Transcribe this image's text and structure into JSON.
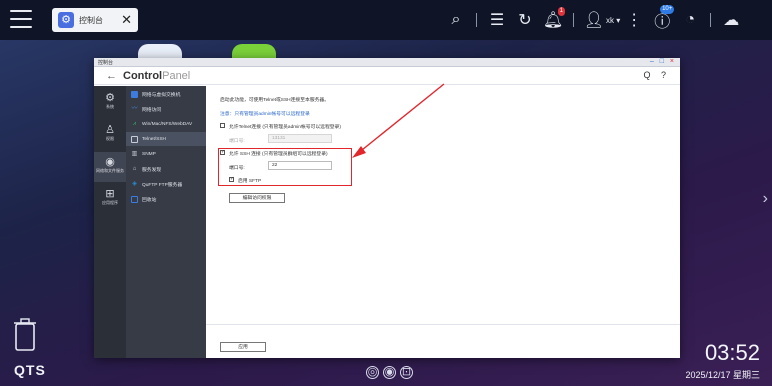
{
  "desktop": {
    "app_tab_label": "控制台",
    "tab_close": "✕",
    "user_name": "xk",
    "badges": {
      "notifications": "1",
      "info": "10+"
    },
    "os_label": "QTS",
    "clock_time": "03:52",
    "clock_date": "2025/12/17 星期三"
  },
  "window": {
    "title": "控制台",
    "controls": {
      "minimize": "–",
      "maximize": "□",
      "close": "×"
    },
    "brand_strong": "Control",
    "brand_light": "Panel",
    "header_icons": "Q ?"
  },
  "rail": [
    {
      "icon": "gear-icon",
      "glyph": "⚙",
      "label": "系统"
    },
    {
      "icon": "user-icon",
      "glyph": "♙",
      "label": "权限"
    },
    {
      "icon": "globe-icon",
      "glyph": "◉",
      "label": "网络和文件服务"
    },
    {
      "icon": "apps-icon",
      "glyph": "⊞",
      "label": "应用程序"
    }
  ],
  "subnav": [
    {
      "icon": "network-switch-icon",
      "label": "网络与虚拟交换机",
      "color": "#3d7be0"
    },
    {
      "icon": "network-access-icon",
      "label": "网络访问",
      "color": "#4a90e2"
    },
    {
      "icon": "win-mac-nfs-icon",
      "label": "Win/Mac/NFS/WebDAV",
      "color": "#3bb36a"
    },
    {
      "icon": "telnet-ssh-icon",
      "label": "Telnet/SSH",
      "color": "#8a94a8"
    },
    {
      "icon": "snmp-icon",
      "label": "SNMP",
      "color": "#6c7a90"
    },
    {
      "icon": "service-discovery-icon",
      "label": "服务发现",
      "color": "#5f6d85"
    },
    {
      "icon": "ftp-icon",
      "label": "QuFTP FTP服务器",
      "color": "#2a8fd8"
    },
    {
      "icon": "recycle-bin-icon",
      "label": "回收站",
      "color": "#3d7be0"
    }
  ],
  "content": {
    "intro": "启动此功能，可使用Telnet或SSH连接至本服务器。",
    "note": "注意：只有管理员admin帐号可以远程登录",
    "telnet_label": "允许Telnet连接 (只有管理员admin帐号可以远程登录)",
    "telnet_port_label": "端口号:",
    "telnet_port_value": "13131",
    "ssh_label": "允许 SSH 连接 (只有管理员群组可以远程登录)",
    "ssh_port_label": "端口号:",
    "ssh_port_value": "22",
    "sftp_label": "启用 SFTP",
    "edit_access_button": "编辑访问权限",
    "apply_button": "应用"
  },
  "states": {
    "telnet_enabled": false,
    "ssh_enabled": true,
    "sftp_enabled": true
  },
  "annotation_color": "#e3262c"
}
